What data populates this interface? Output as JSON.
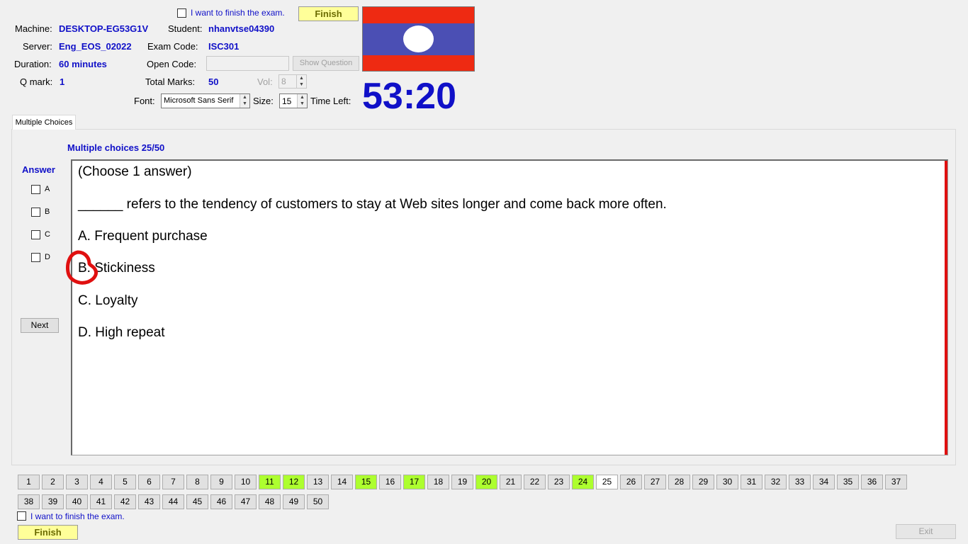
{
  "header": {
    "finish_check_label": "I want to finish the exam.",
    "finish_button": "Finish",
    "machine_label": "Machine:",
    "machine_value": "DESKTOP-EG53G1V",
    "student_label": "Student:",
    "student_value": "nhanvtse04390",
    "server_label": "Server:",
    "server_value": "Eng_EOS_02022",
    "exam_code_label": "Exam Code:",
    "exam_code_value": "ISC301",
    "duration_label": "Duration:",
    "duration_value": "60 minutes",
    "open_code_label": "Open Code:",
    "open_code_value": "",
    "show_question_button": "Show Question",
    "qmark_label": "Q mark:",
    "qmark_value": "1",
    "total_marks_label": "Total Marks:",
    "total_marks_value": "50",
    "vol_label": "Vol:",
    "vol_value": "8",
    "font_label": "Font:",
    "font_value": "Microsoft Sans Serif",
    "size_label": "Size:",
    "size_value": "15",
    "time_left_label": "Time Left:",
    "time_left_value": "53:20"
  },
  "colors": {
    "flag_red": "#ee2a12",
    "flag_blue": "#4b4fb4",
    "value_blue": "#1010c8",
    "answered_green": "#adff2f",
    "finish_yellow": "#ffff99",
    "scroll_red": "#e01010"
  },
  "tab": {
    "label": "Multiple Choices"
  },
  "question": {
    "counter": "Multiple choices 25/50",
    "answer_heading": "Answer",
    "answer_options": [
      "A",
      "B",
      "C",
      "D"
    ],
    "next_button": "Next",
    "lines": [
      "(Choose 1 answer)",
      "______ refers to the tendency of customers to stay at Web sites longer and come back more often.",
      "A.  Frequent purchase",
      "B.  Stickiness",
      "C.  Loyalty",
      "D.  High repeat"
    ],
    "circled_option": "B"
  },
  "navigation": {
    "row1": [
      "1",
      "2",
      "3",
      "4",
      "5",
      "6",
      "7",
      "8",
      "9",
      "10",
      "11",
      "12",
      "13",
      "14",
      "15",
      "16",
      "17",
      "18",
      "19",
      "20",
      "21",
      "22",
      "23",
      "24",
      "25",
      "26",
      "27",
      "28",
      "29",
      "30",
      "31",
      "32",
      "33",
      "34",
      "35",
      "36",
      "37"
    ],
    "row2": [
      "38",
      "39",
      "40",
      "41",
      "42",
      "43",
      "44",
      "45",
      "46",
      "47",
      "48",
      "49",
      "50"
    ],
    "answered": [
      "11",
      "12",
      "15",
      "17",
      "20",
      "24"
    ],
    "current": "25"
  },
  "footer": {
    "finish_check_label": "I want to finish the exam.",
    "finish_button": "Finish",
    "exit_button": "Exit"
  }
}
